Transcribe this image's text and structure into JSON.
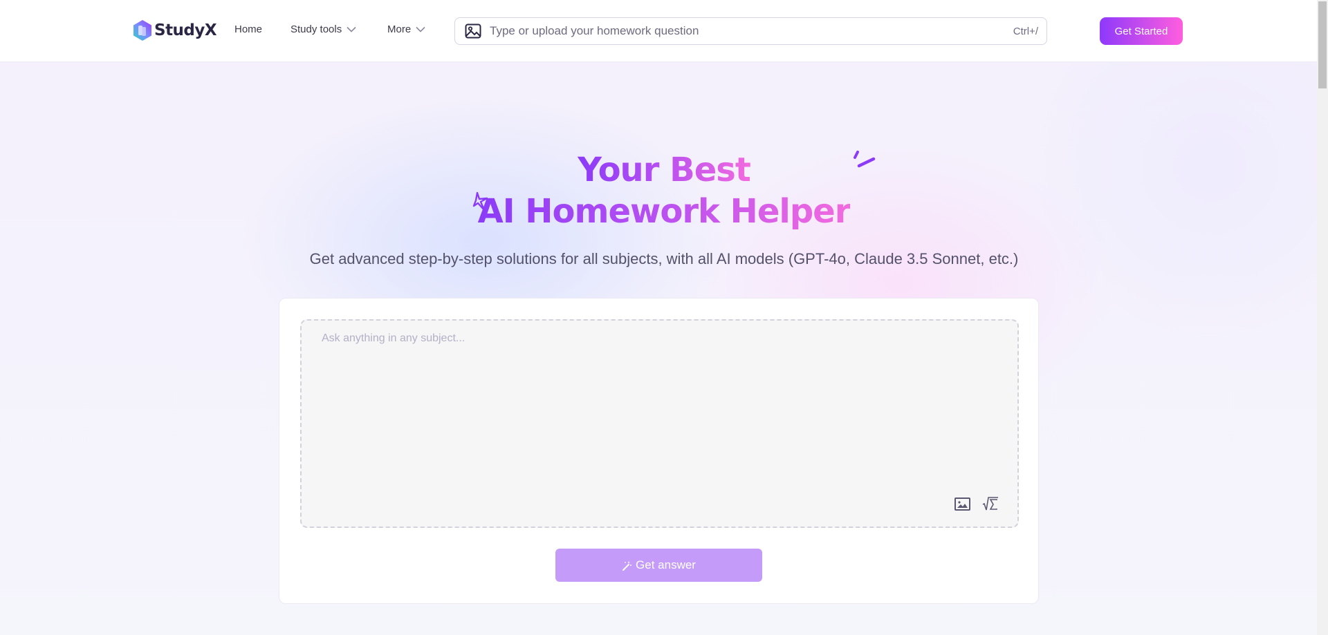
{
  "header": {
    "brand": "StudyX",
    "nav": [
      {
        "label": "Home",
        "has_dropdown": false
      },
      {
        "label": "Study tools",
        "has_dropdown": true
      },
      {
        "label": "More",
        "has_dropdown": true
      }
    ],
    "search": {
      "placeholder": "Type or upload your homework question",
      "value": "",
      "shortcut": "Ctrl+/",
      "icon": "image-upload-icon"
    },
    "cta_label": "Get Started"
  },
  "hero": {
    "title_line1": "Your Best",
    "title_line2": "AI Homework Helper",
    "subtitle": "Get advanced step-by-step solutions for all subjects, with all AI models (GPT-4o, Claude 3.5 Sonnet, etc.)"
  },
  "question_box": {
    "placeholder": "Ask anything in any subject...",
    "value": "",
    "tools": [
      {
        "icon": "image-icon",
        "label": "Upload image"
      },
      {
        "icon": "formula-icon",
        "label": "Insert formula"
      }
    ],
    "submit_label": "Get answer",
    "submit_icon": "magic-wand-icon"
  },
  "colors": {
    "brand_start": "#8e39fb",
    "brand_end": "#ff5ede",
    "submit_disabled": "#c59bfa",
    "text_dark": "#2a2744"
  }
}
